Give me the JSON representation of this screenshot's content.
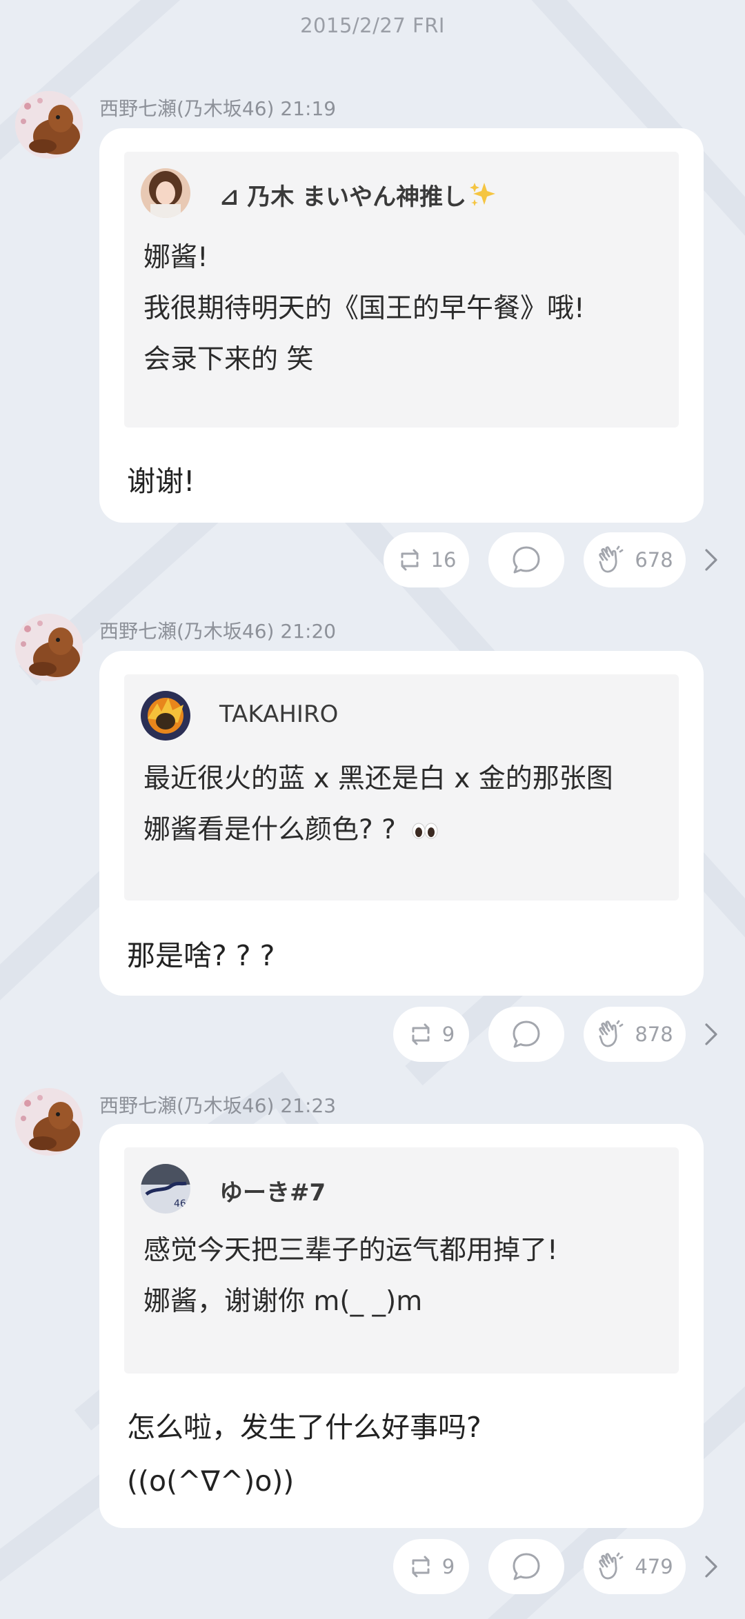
{
  "date_label": "2015/2/27 FRI",
  "colors": {
    "background": "#e9edf3",
    "bubble": "#ffffff",
    "quote_box": "#f4f4f5",
    "meta_text": "#8d9199",
    "sparkle": "#f5c542"
  },
  "posts": [
    {
      "sender": "西野七瀬(乃木坂46)",
      "time": "21:19",
      "quote": {
        "name": "⊿ 乃木 まいやん神推し",
        "name_emoji": "sparkles",
        "lines": [
          "娜酱!",
          "我很期待明天的《国王的早午餐》哦!",
          "会录下来的 笑"
        ]
      },
      "reply": [
        "谢谢!"
      ],
      "repost_count": "16",
      "clap_count": "678"
    },
    {
      "sender": "西野七瀬(乃木坂46)",
      "time": "21:20",
      "quote": {
        "name": "TAKAHIRO",
        "lines": [
          "最近很火的蓝 x 黑还是白 x 金的那张图",
          "娜酱看是什么颜色? ?"
        ],
        "line_emoji": "eyes"
      },
      "reply": [
        "那是啥? ? ?"
      ],
      "repost_count": "9",
      "clap_count": "878"
    },
    {
      "sender": "西野七瀬(乃木坂46)",
      "time": "21:23",
      "quote": {
        "name": "ゆーき#7",
        "lines": [
          "感觉今天把三辈子的运气都用掉了!",
          "娜酱，谢谢你 m(_ _)m"
        ]
      },
      "reply": [
        "怎么啦，发生了什么好事吗?",
        "((o(^∇^)o))"
      ],
      "repost_count": "9",
      "clap_count": "479"
    }
  ],
  "icons": {
    "repost": "repost-icon",
    "comment": "comment-icon",
    "clap": "clap-icon",
    "more": "chevron-right-icon"
  }
}
